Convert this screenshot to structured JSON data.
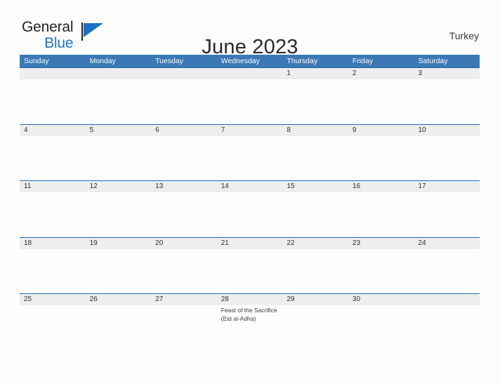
{
  "brand": {
    "name_part1": "General",
    "name_part2": "Blue",
    "flag_icon": "blue-triangle-flag-icon",
    "accent_color": "#1c72c0"
  },
  "header": {
    "title": "June 2023",
    "country": "Turkey"
  },
  "colors": {
    "header_blue": "#3b78b5",
    "banner_gray": "#eeeeee",
    "banner_rule": "#1f6cb0",
    "page_background": "#fdfdfe",
    "title_text": "#2a2a2a"
  },
  "calendar": {
    "weekdays": [
      "Sunday",
      "Monday",
      "Tuesday",
      "Wednesday",
      "Thursday",
      "Friday",
      "Saturday"
    ],
    "weeks": [
      [
        {
          "day": "",
          "events": []
        },
        {
          "day": "",
          "events": []
        },
        {
          "day": "",
          "events": []
        },
        {
          "day": "",
          "events": []
        },
        {
          "day": "1",
          "events": []
        },
        {
          "day": "2",
          "events": []
        },
        {
          "day": "3",
          "events": []
        }
      ],
      [
        {
          "day": "4",
          "events": []
        },
        {
          "day": "5",
          "events": []
        },
        {
          "day": "6",
          "events": []
        },
        {
          "day": "7",
          "events": []
        },
        {
          "day": "8",
          "events": []
        },
        {
          "day": "9",
          "events": []
        },
        {
          "day": "10",
          "events": []
        }
      ],
      [
        {
          "day": "11",
          "events": []
        },
        {
          "day": "12",
          "events": []
        },
        {
          "day": "13",
          "events": []
        },
        {
          "day": "14",
          "events": []
        },
        {
          "day": "15",
          "events": []
        },
        {
          "day": "16",
          "events": []
        },
        {
          "day": "17",
          "events": []
        }
      ],
      [
        {
          "day": "18",
          "events": []
        },
        {
          "day": "19",
          "events": []
        },
        {
          "day": "20",
          "events": []
        },
        {
          "day": "21",
          "events": []
        },
        {
          "day": "22",
          "events": []
        },
        {
          "day": "23",
          "events": []
        },
        {
          "day": "24",
          "events": []
        }
      ],
      [
        {
          "day": "25",
          "events": []
        },
        {
          "day": "26",
          "events": []
        },
        {
          "day": "27",
          "events": []
        },
        {
          "day": "28",
          "events": [
            "Feast of the Sacrifice (Eid al-Adha)"
          ]
        },
        {
          "day": "29",
          "events": []
        },
        {
          "day": "30",
          "events": []
        },
        {
          "day": "",
          "events": []
        }
      ]
    ]
  }
}
